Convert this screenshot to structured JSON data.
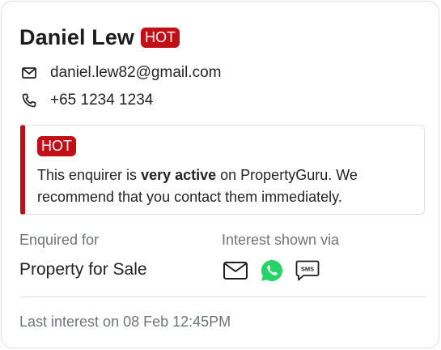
{
  "contact": {
    "name": "Daniel Lew",
    "status_badge": "HOT",
    "email": "daniel.lew82@gmail.com",
    "phone": "+65 1234 1234"
  },
  "alert": {
    "badge": "HOT",
    "text_before": "This enquirer is ",
    "text_bold": "very active",
    "text_after": " on PropertyGuru. We recommend that you contact them immediately."
  },
  "enquiry": {
    "enquired_for_label": "Enquired for",
    "enquired_for_value": "Property for Sale",
    "interest_label": "Interest shown via",
    "channels": [
      {
        "name": "email-icon"
      },
      {
        "name": "whatsapp-icon"
      },
      {
        "name": "sms-icon",
        "text": "SMS"
      }
    ]
  },
  "footer": {
    "last_interest": "Last interest on 08 Feb 12:45PM"
  },
  "colors": {
    "hot": "#c20e15",
    "whatsapp": "#25d366",
    "border": "#dcdfe6",
    "muted_text": "#6f7478"
  }
}
